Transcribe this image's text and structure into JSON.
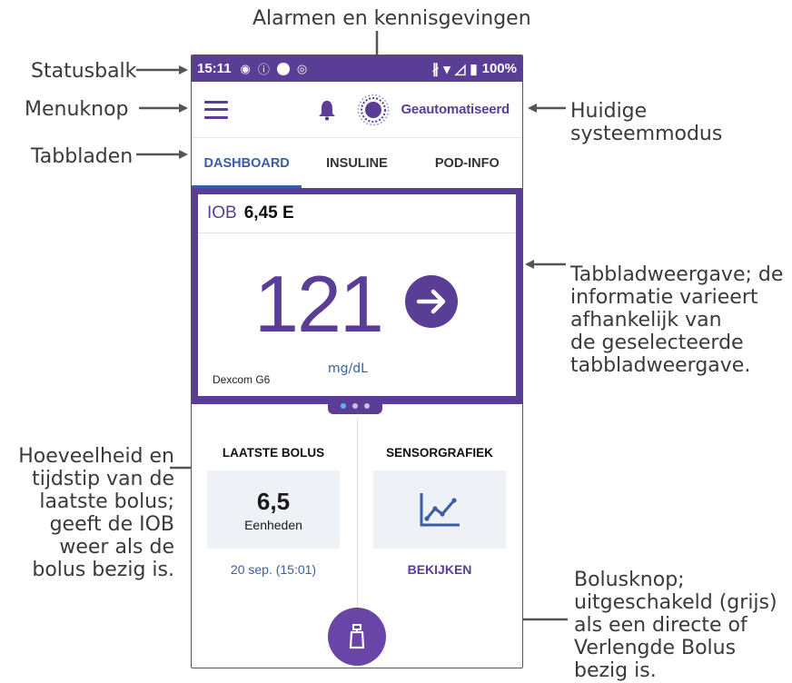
{
  "callouts": {
    "alarms": "Alarmen en kennisgevingen",
    "statusbar": "Statusbalk",
    "menu_button": "Menuknop",
    "tabs": "Tabbladen",
    "mode_line1": "Huidige",
    "mode_line2": "systeemmodus",
    "tabview": [
      "Tabbladweergave; de",
      "informatie varieert",
      "afhankelijk van",
      "de geselecteerde",
      "tabbladweergave."
    ],
    "last_bolus": [
      "Hoeveelheid en",
      "tijdstip van de",
      "laatste bolus;",
      "geeft de IOB",
      "weer als de",
      "bolus bezig is."
    ],
    "bolus_button": [
      "Bolusknop;",
      "uitgeschakeld (grijs)",
      "als een directe of",
      "Verlengde Bolus",
      "bezig is."
    ]
  },
  "statusbar": {
    "time": "15:11",
    "battery": "100%"
  },
  "appbar": {
    "mode": "Geautomatiseerd"
  },
  "tabs": [
    "DASHBOARD",
    "INSULINE",
    "POD-INFO"
  ],
  "dashboard": {
    "iob_label": "IOB",
    "iob_value": "6,45 E",
    "glucose": "121",
    "unit": "mg/dL",
    "source": "Dexcom G6"
  },
  "last_bolus": {
    "title": "LAATSTE BOLUS",
    "amount": "6,5",
    "unit": "Eenheden",
    "time": "20 sep. (15:01)"
  },
  "sensor": {
    "title": "SENSORGRAFIEK",
    "link": "BEKIJKEN"
  },
  "colors": {
    "primary": "#5a3e96",
    "tab_active": "#3a5da8",
    "card_bg": "#eef2f7"
  },
  "icons": [
    "menu-icon",
    "bell-icon",
    "automated-mode-icon",
    "trend-arrow-right-icon",
    "sensor-graph-icon",
    "bolus-pod-icon",
    "bluetooth-icon",
    "wifi-icon",
    "signal-icon",
    "battery-icon"
  ]
}
